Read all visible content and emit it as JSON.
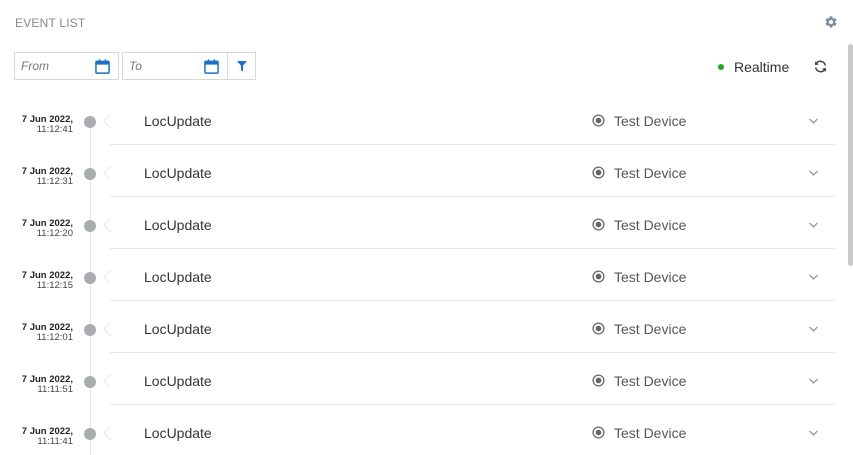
{
  "header": {
    "title": "EVENT LIST",
    "settings_icon": "gear-icon"
  },
  "toolbar": {
    "from_placeholder": "From",
    "to_placeholder": "To",
    "calendar_icon": "calendar-icon",
    "filter_icon": "filter-icon",
    "realtime_label": "Realtime",
    "realtime_status_color": "#22a722",
    "refresh_icon": "refresh-icon"
  },
  "colors": {
    "accent": "#1a73c7",
    "timeline_dot": "#a9acaf"
  },
  "events": [
    {
      "date": "7 Jun 2022,",
      "time": "11:12:41",
      "type": "LocUpdate",
      "device": "Test Device"
    },
    {
      "date": "7 Jun 2022,",
      "time": "11:12:31",
      "type": "LocUpdate",
      "device": "Test Device"
    },
    {
      "date": "7 Jun 2022,",
      "time": "11:12:20",
      "type": "LocUpdate",
      "device": "Test Device"
    },
    {
      "date": "7 Jun 2022,",
      "time": "11:12:15",
      "type": "LocUpdate",
      "device": "Test Device"
    },
    {
      "date": "7 Jun 2022,",
      "time": "11:12:01",
      "type": "LocUpdate",
      "device": "Test Device"
    },
    {
      "date": "7 Jun 2022,",
      "time": "11:11:51",
      "type": "LocUpdate",
      "device": "Test Device"
    },
    {
      "date": "7 Jun 2022,",
      "time": "11:11:41",
      "type": "LocUpdate",
      "device": "Test Device"
    }
  ]
}
